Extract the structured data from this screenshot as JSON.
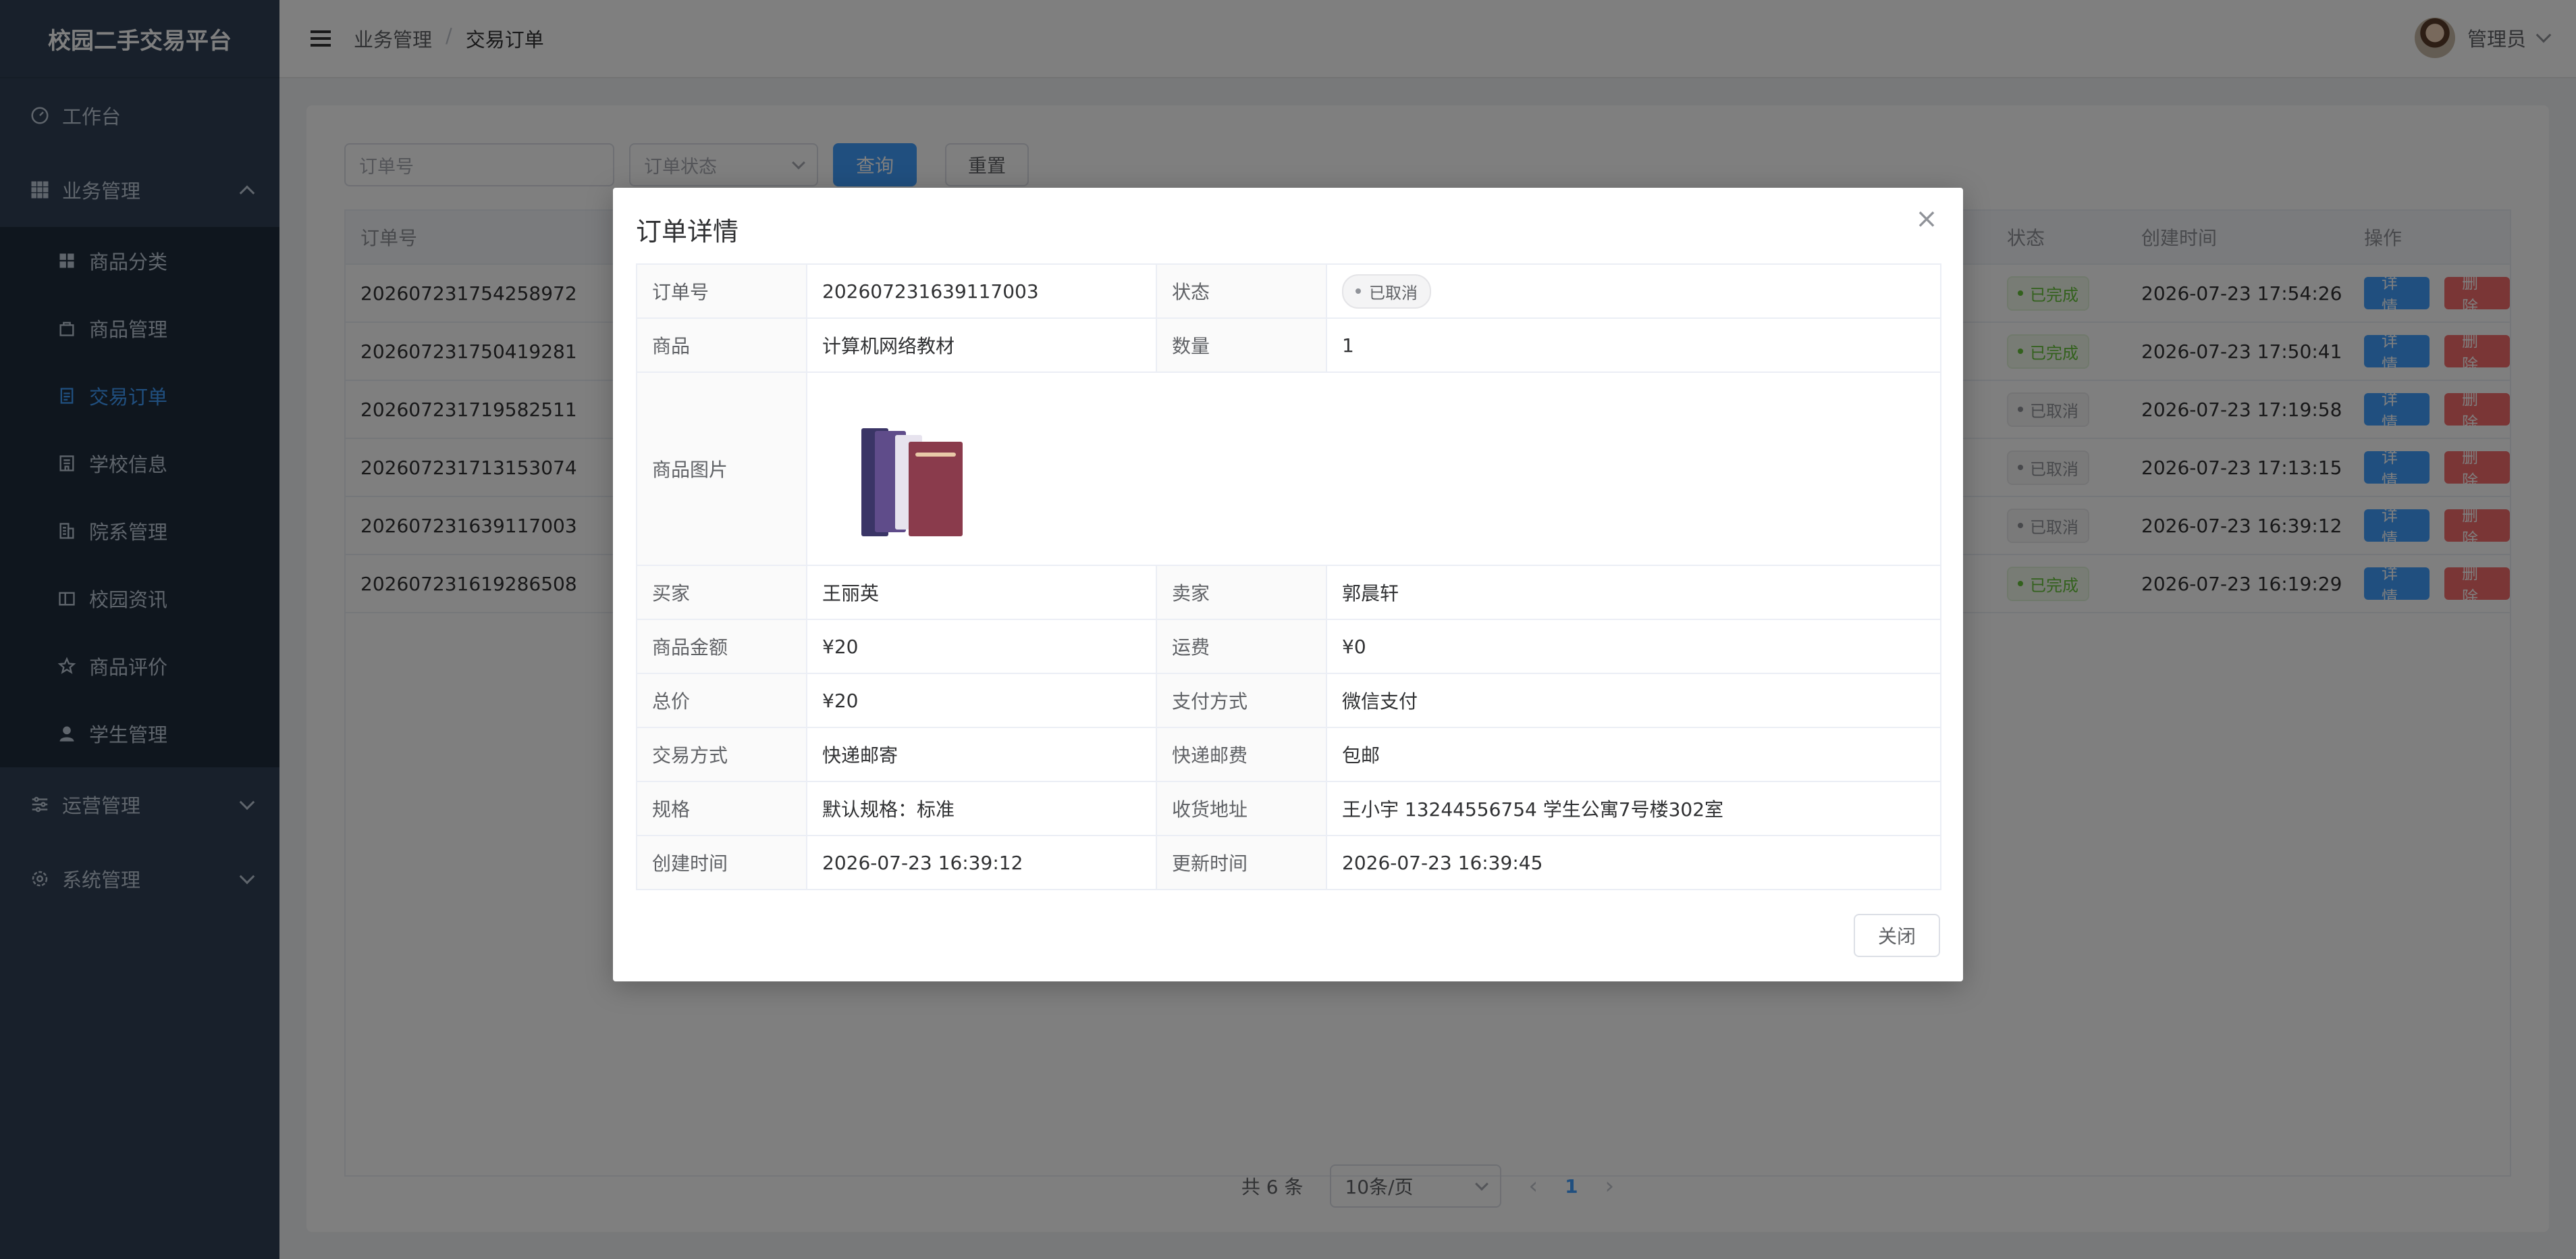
{
  "app": {
    "title": "校园二手交易平台",
    "accent_color": "#409eff",
    "sidebar_bg": "#304156"
  },
  "sidebar": {
    "items": [
      {
        "label": "工作台",
        "icon": "dashboard-icon"
      },
      {
        "label": "业务管理",
        "icon": "grid-icon",
        "expanded": true
      },
      {
        "label": "运营管理",
        "icon": "sliders-icon",
        "expanded": false
      },
      {
        "label": "系统管理",
        "icon": "gear-icon",
        "expanded": false
      }
    ],
    "business_sub": [
      {
        "label": "商品分类",
        "icon": "category-icon"
      },
      {
        "label": "商品管理",
        "icon": "bag-icon"
      },
      {
        "label": "交易订单",
        "icon": "document-icon",
        "active": true
      },
      {
        "label": "学校信息",
        "icon": "school-icon"
      },
      {
        "label": "院系管理",
        "icon": "building-icon"
      },
      {
        "label": "校园资讯",
        "icon": "book-icon"
      },
      {
        "label": "商品评价",
        "icon": "star-icon"
      },
      {
        "label": "学生管理",
        "icon": "user-icon"
      }
    ]
  },
  "header": {
    "breadcrumb": [
      "业务管理",
      "交易订单"
    ],
    "breadcrumb_sep": "/",
    "user_name": "管理员"
  },
  "filters": {
    "order_no_placeholder": "订单号",
    "status_placeholder": "订单状态",
    "search_label": "查询",
    "reset_label": "重置"
  },
  "table": {
    "headers": {
      "order_no": "订单号",
      "status": "状态",
      "created": "创建时间",
      "ops": "操作"
    },
    "detail_label": "详情",
    "delete_label": "删除",
    "rows": [
      {
        "order_no": "202607231754258972",
        "status": "已完成",
        "created": "2026-07-23 17:54:26",
        "status_type": "done"
      },
      {
        "order_no": "202607231750419281",
        "status": "已完成",
        "created": "2026-07-23 17:50:41",
        "status_type": "done"
      },
      {
        "order_no": "202607231719582511",
        "status": "已取消",
        "created": "2026-07-23 17:19:58",
        "status_type": "cancel"
      },
      {
        "order_no": "202607231713153074",
        "status": "已取消",
        "created": "2026-07-23 17:13:15",
        "status_type": "cancel"
      },
      {
        "order_no": "202607231639117003",
        "status": "已取消",
        "created": "2026-07-23 16:39:12",
        "status_type": "cancel"
      },
      {
        "order_no": "202607231619286508",
        "status": "已完成",
        "created": "2026-07-23 16:19:29",
        "status_type": "done"
      }
    ]
  },
  "pagination": {
    "total": "共 6 条",
    "page_size": "10条/页",
    "current_page": "1",
    "prev": "‹",
    "next": "›"
  },
  "dialog": {
    "title": "订单详情",
    "close_symbol": "×",
    "close_button": "关闭",
    "fields": {
      "order_no_label": "订单号",
      "order_no": "202607231639117003",
      "status_label": "状态",
      "status": "已取消",
      "product_label": "商品",
      "product": "计算机网络教材",
      "qty_label": "数量",
      "qty": "1",
      "image_label": "商品图片",
      "buyer_label": "买家",
      "buyer": "王丽英",
      "seller_label": "卖家",
      "seller": "郭晨轩",
      "amount_label": "商品金额",
      "amount": "¥20",
      "shipping_label": "运费",
      "shipping": "¥0",
      "total_label": "总价",
      "total": "¥20",
      "payment_label": "支付方式",
      "payment": "微信支付",
      "trade_label": "交易方式",
      "trade": "快递邮寄",
      "express_fee_label": "快递邮费",
      "express_fee": "包邮",
      "spec_label": "规格",
      "spec": "默认规格：标准",
      "address_label": "收货地址",
      "address": "王小宇 13244556754 学生公寓7号楼302室",
      "created_label": "创建时间",
      "created": "2026-07-23 16:39:12",
      "updated_label": "更新时间",
      "updated": "2026-07-23 16:39:45"
    }
  }
}
